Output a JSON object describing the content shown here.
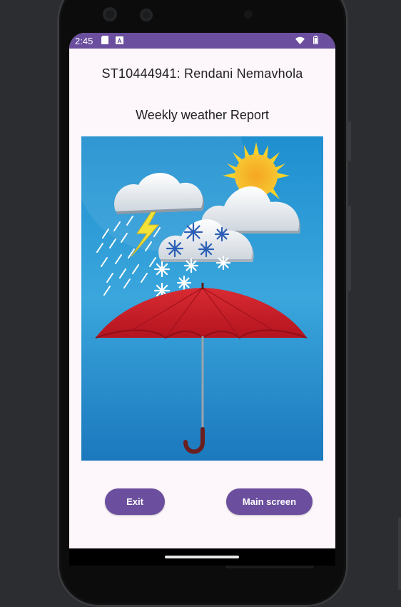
{
  "statusbar": {
    "time": "2:45",
    "left_icons": [
      "sd-card-icon",
      "a-notification-icon"
    ],
    "right_icons": [
      "wifi-icon",
      "battery-icon"
    ],
    "color": "#6b4f9e"
  },
  "app": {
    "title": "ST10444941: Rendani Nemavhola",
    "subtitle": "Weekly weather Report",
    "image_description_icons": [
      "sun-icon",
      "cloud-icon",
      "lightning-icon",
      "snowflake-icon",
      "rain-icon",
      "umbrella-icon"
    ]
  },
  "buttons": {
    "exit_label": "Exit",
    "main_label": "Main screen",
    "color": "#6b4f9e"
  }
}
